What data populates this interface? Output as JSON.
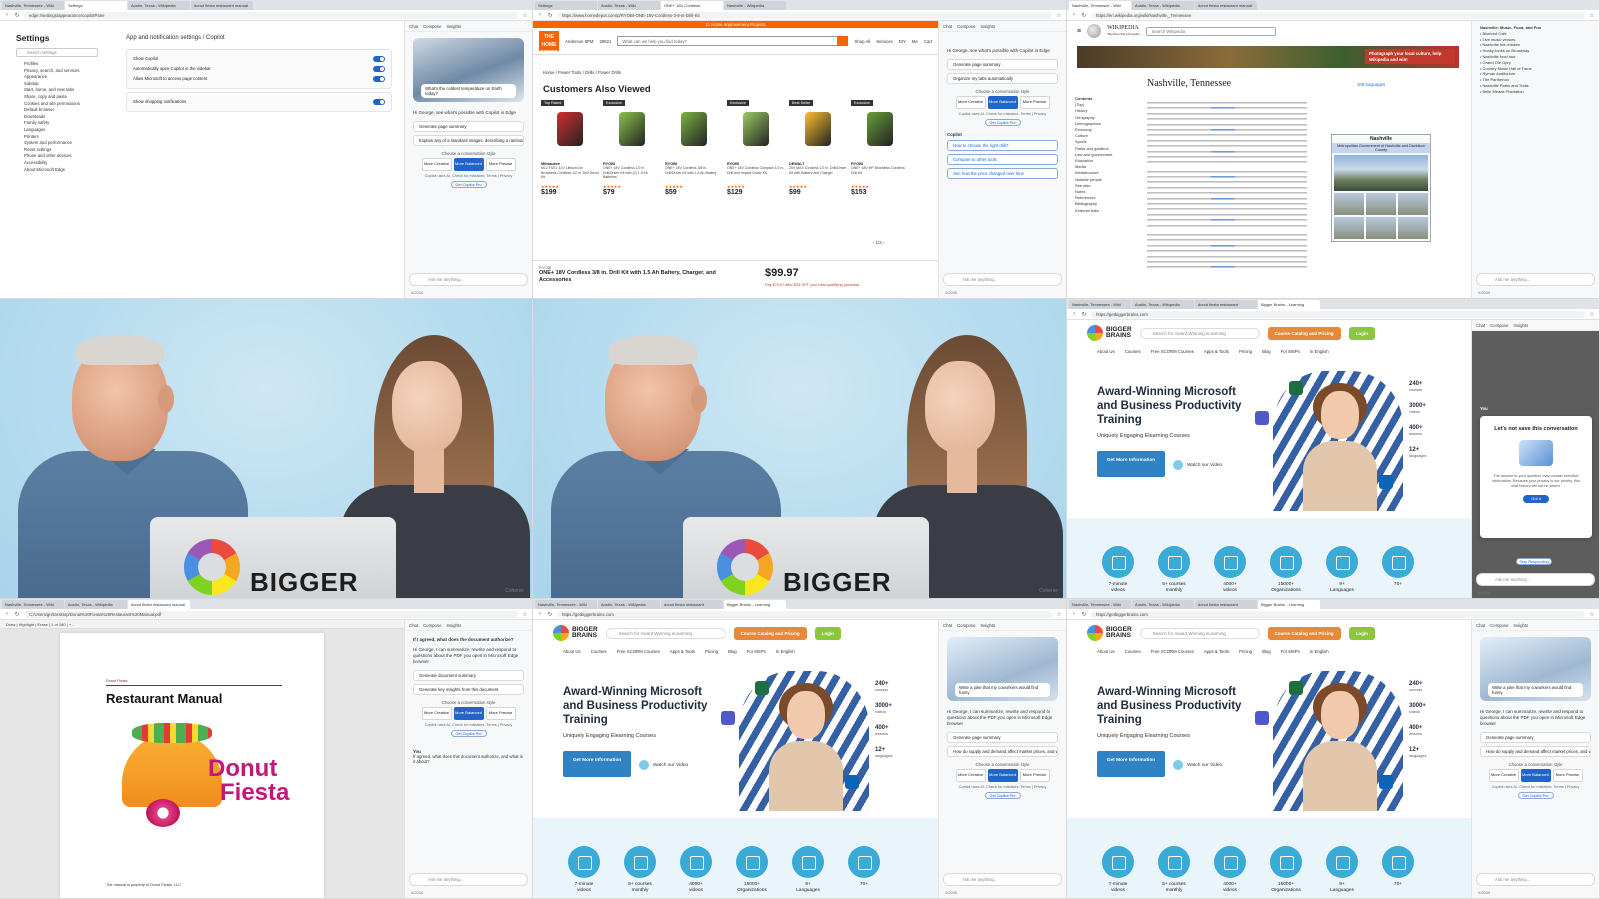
{
  "settings": {
    "tabs": [
      "Nashville, Tennessee - Wiki",
      "Settings",
      "Austin, Texas - Wikipedia",
      "donut fiesta restaurant manual"
    ],
    "url": "edge://settings/appearance/copilotPane",
    "title": "Settings",
    "search_placeholder": "Search settings",
    "nav": [
      "Profiles",
      "Privacy, search, and services",
      "Appearance",
      "Sidebar",
      "Start, home, and new tabs",
      "Share, copy and paste",
      "Cookies and site permissions",
      "Default browser",
      "Downloads",
      "Family safety",
      "Languages",
      "Printers",
      "System and performance",
      "Reset settings",
      "Phone and other devices",
      "Accessibility",
      "About Microsoft Edge"
    ],
    "breadcrumb": "App and notification settings / Copilot",
    "section_label": "Show Copilot",
    "rows": [
      "Automatically open Copilot in the sidebar",
      "Allow Microsoft to access page content",
      "Show shopping notifications"
    ]
  },
  "copilot": {
    "header": [
      "Chat",
      "Compose",
      "Insights"
    ],
    "hero_question": "What's the coldest temperature on Earth today?",
    "greeting": "Hi George, see what's possible with Copilot in Edge",
    "suggestions": [
      "Generate page summary",
      "Explain any of a standard images, describing a rainbow of colors"
    ],
    "style_label": "Choose a conversation style",
    "styles": [
      "More Creative",
      "More Balanced",
      "More Precise"
    ],
    "note": "Copilot uses AI. Check for mistakes. Terms | Privacy",
    "pill": "Get Copilot Pro",
    "input_placeholder": "Ask me anything...",
    "counter": "0/2000"
  },
  "homedepot": {
    "tabs": [
      "Settings",
      "Austin, Texas - Wiki",
      "ONE+ 18V Cordless",
      "Nashville - Wikipedia"
    ],
    "url": "https://www.homedepot.com/p/RYOBI-ONE-18V-Cordless-3-8-in-Drill-Kit",
    "banner": "11 Home Improvement Projects",
    "logo": "THE HOME DEPOT",
    "store": "Anderson 8PM",
    "zip": "29621",
    "search_placeholder": "What can we help you find today?",
    "nav": [
      "Shop All",
      "Services",
      "DIY",
      "Me",
      "Cart"
    ],
    "breadcrumb": "Home / Power Tools / Drills / Power Drills",
    "section_title": "Customers Also Viewed",
    "products": [
      {
        "tag": "Top Rated",
        "brand": "Milwaukee",
        "desc": "M12 FUEL 12V Lithium-Ion Brushless Cordless 1/2 in. Drill Driver Kit",
        "price": "$199",
        "color": "#d32f2f"
      },
      {
        "tag": "Exclusive",
        "brand": "RYOBI",
        "desc": "ONE+ 18V Cordless 1/2 in. Drill/Driver Kit with (2) 1.5 Ah Batteries",
        "price": "$79",
        "color": "#8bc34a"
      },
      {
        "tag": "",
        "brand": "RYOBI",
        "desc": "ONE+ 18V Cordless 3/8 in. Drill/Driver Kit with 1.5 Ah Battery",
        "price": "$59",
        "color": "#7cb342"
      },
      {
        "tag": "Exclusive",
        "brand": "RYOBI",
        "desc": "ONE+ 18V Cordless Compact 1/2 in. Drill and Impact Driver Kit",
        "price": "$129",
        "color": "#9ccc65"
      },
      {
        "tag": "Best Seller",
        "brand": "DEWALT",
        "desc": "20V MAX Cordless 1/2 in. Drill/Driver Kit with Battery and Charger",
        "price": "$99",
        "color": "#fbc02d"
      },
      {
        "tag": "Exclusive",
        "brand": "RYOBI",
        "desc": "ONE+ 18V HP Brushless Cordless Drill Kit",
        "price": "$153",
        "color": "#689f38"
      }
    ],
    "pager": "1/3",
    "bottom_brand": "RYOBI",
    "bottom_name": "ONE+ 18V Cordless 3/8 in. Drill Kit with 1.5 Ah Battery, Charger, and Accessories",
    "bottom_price": "$99.97",
    "bottom_sub": "Pay $74.97 after $25 OFF your total qualifying purchase",
    "pane_items": [
      "Generate page summary",
      "Organize my tabs automatically"
    ],
    "pane_user": "Copilot",
    "pane_asks": [
      "How to choose the right drill?",
      "Compare to other tools",
      "See how the price changed over time"
    ]
  },
  "wikipedia": {
    "tabs": [
      "Nashville, Tennessee - Wiki",
      "Austin, Texas - Wikipedia",
      "donut fiesta restaurant manual"
    ],
    "url": "https://en.wikipedia.org/wiki/Nashville,_Tennessee",
    "logo": "WIKIPEDIA",
    "logo_sub": "The Free Encyclopedia",
    "search_placeholder": "Search Wikipedia",
    "banner_text": "Photograph your local culture, help Wikipedia and win!",
    "title": "Nashville, Tennessee",
    "languages": "106 languages",
    "toc_head": "Contents",
    "toc": [
      "(Top)",
      "History",
      "Geography",
      "Demographics",
      "Economy",
      "Culture",
      "Sports",
      "Parks and gardens",
      "Law and government",
      "Education",
      "Media",
      "Infrastructure",
      "Notable people",
      "See also",
      "Notes",
      "References",
      "Bibliography",
      "External links"
    ],
    "info_title": "Nashville",
    "info_sub": "Metropolitan Government of Nashville and Davidson County",
    "pane_list": [
      "Nashville: Music, Food, and Fun",
      "Bluebird Cafe",
      "Live music venues",
      "Nashville hot chicken",
      "Honky-tonks on Broadway",
      "Nashville food tour",
      "Grand Ole Opry",
      "Country Music Hall of Fame",
      "Ryman Auditorium",
      "The Parthenon",
      "Nashville Parks and Trails",
      "Belle Meade Plantation"
    ]
  },
  "video": {
    "laptop_text": "BIGGER",
    "watermark": "Coherse"
  },
  "biggerbrains": {
    "tabs": [
      "Nashville, Tennessee - Wiki",
      "Austin, Texas - Wikipedia",
      "donut fiesta restaurant",
      "Bigger Brains - Learning"
    ],
    "url": "https://getbiggerbrains.com",
    "logo_1": "BIGGER",
    "logo_2": "BRAINS",
    "search_placeholder": "Search for Award Winning eLearning",
    "cta_catalog": "Course Catalog and Pricing",
    "cta_login": "Login",
    "nav": [
      "About Us",
      "Courses",
      "Free SCORM Courses",
      "Apps & Tools",
      "Pricing",
      "Blog",
      "For MSPs",
      "In English"
    ],
    "hero_title": "Award-Winning Microsoft and Business Productivity Training",
    "hero_sub": "Uniquely Engaging Elearning Courses",
    "more_btn": "Get More Information",
    "watch": "Watch our Video",
    "stats": [
      {
        "n": "240+",
        "l": "courses"
      },
      {
        "n": "3000+",
        "l": "videos"
      },
      {
        "n": "400+",
        "l": "lessons"
      },
      {
        "n": "12+",
        "l": "languages"
      }
    ],
    "features": [
      {
        "n": "7-minute",
        "l": "videos"
      },
      {
        "n": "5+ courses",
        "l": "monthly"
      },
      {
        "n": "4000+",
        "l": "videos"
      },
      {
        "n": "15000+",
        "l": "Organizations"
      },
      {
        "n": "9+",
        "l": "Languages"
      },
      {
        "n": "70+",
        "l": ""
      }
    ],
    "modal_user": "You",
    "modal_title": "Let's not save this conversation",
    "modal_body": "The answer to your question may contain sensitive information. Because your privacy is our priority, this chat history will not be saved.",
    "modal_btn": "Got it",
    "modal_link": "Stop Responding",
    "pane_question": "Write a joke that my coworkers would find funny",
    "pane_greeting": "Hi George, I can summarize, rewrite and respond to questions about the PDF you open in Microsoft Edge browser",
    "pane_sugg": [
      "Generate page summary",
      "How do supply and demand affect market prices, and what are the..."
    ]
  },
  "pdf": {
    "tabs": [
      "Nashville, Tennessee - Wiki",
      "Austin, Texas - Wikipedia",
      "donut fiesta restaurant manual"
    ],
    "url": "C:/Users/gn/Desktop/Donut%20Fiesta%20Restaurant%20Manual.pdf",
    "toolbar": "Draw  |  Highlight  |  Erase  |  1 of 180  |  +  -",
    "tag": "Donut Fiesta",
    "title": "Restaurant Manual",
    "brand_1": "Donut",
    "brand_2": "Fiesta",
    "footer": "The manual is property of Donut Fiesta, LLC",
    "pane_q": "If I agreed, what does the document authorize?",
    "pane_greeting": "Hi George, I can summarize, rewrite and respond to questions about the PDF you open in Microsoft Edge browser",
    "pane_sugg": [
      "Generate document summary",
      "Generate key insights from this document"
    ],
    "you_label": "You",
    "you_msg": "If agreed, what does this document authorize, and what is it about?"
  }
}
